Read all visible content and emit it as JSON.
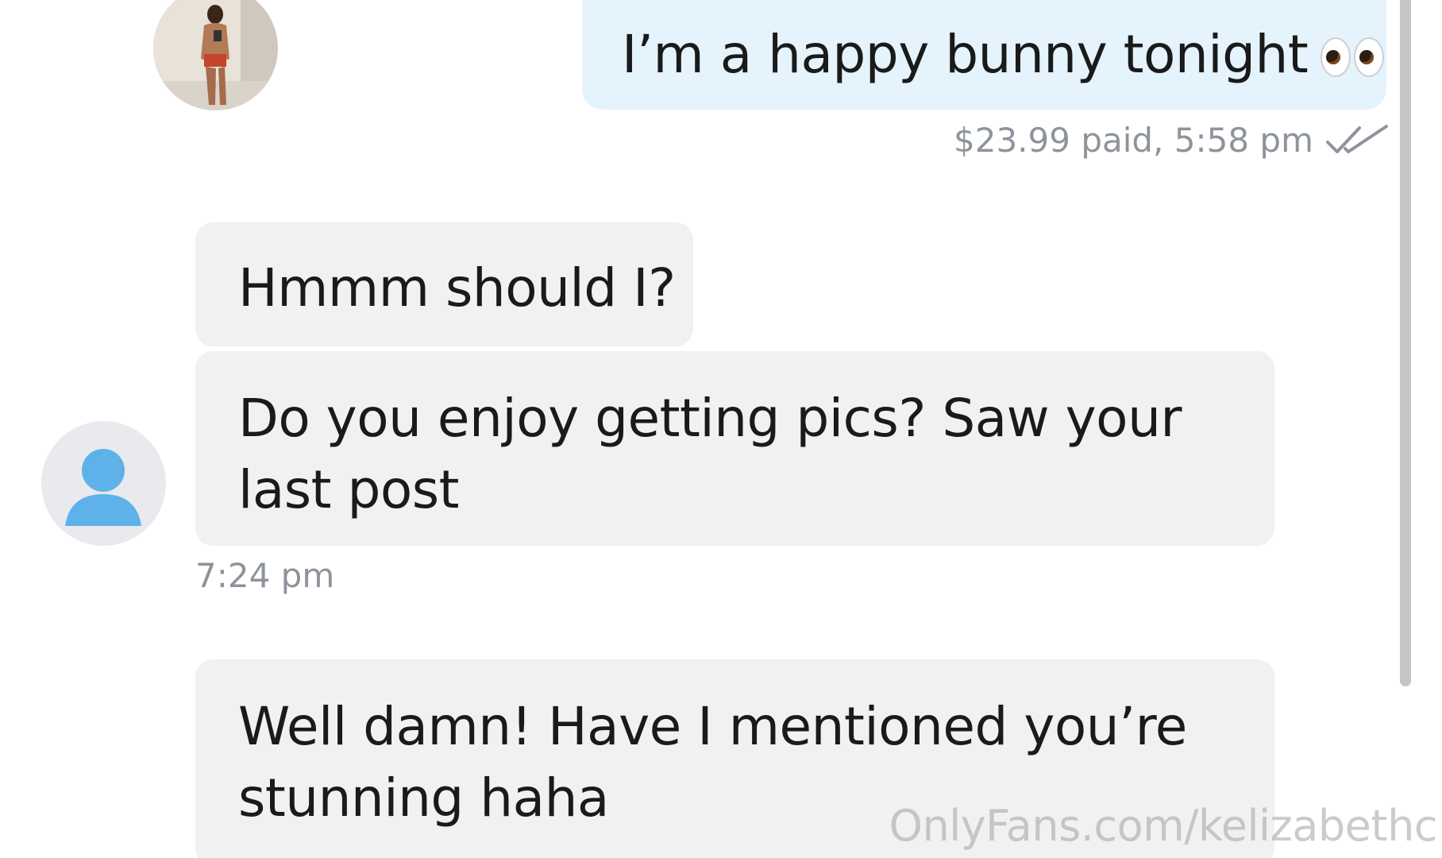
{
  "conversation": {
    "outgoing": {
      "text": "I’m a happy bunny tonight",
      "emoji": "eyes-emoji",
      "meta": "$23.99 paid,  5:58 pm",
      "status_icon": "double-check-icon"
    },
    "incoming": [
      {
        "text": "Hmmm should I?"
      },
      {
        "text": "Do you enjoy getting pics? Saw your last post"
      },
      {
        "text": "Well damn! Have I mentioned you’re stunning haha"
      }
    ],
    "incoming_time": "7:24 pm"
  },
  "watermark": "OnlyFans.com/kelizabethc",
  "colors": {
    "outgoing_bubble": "#e5f3fc",
    "incoming_bubble": "#f0f1f3",
    "meta_text": "#8e949b",
    "avatar_blue": "#5fb1ea"
  }
}
